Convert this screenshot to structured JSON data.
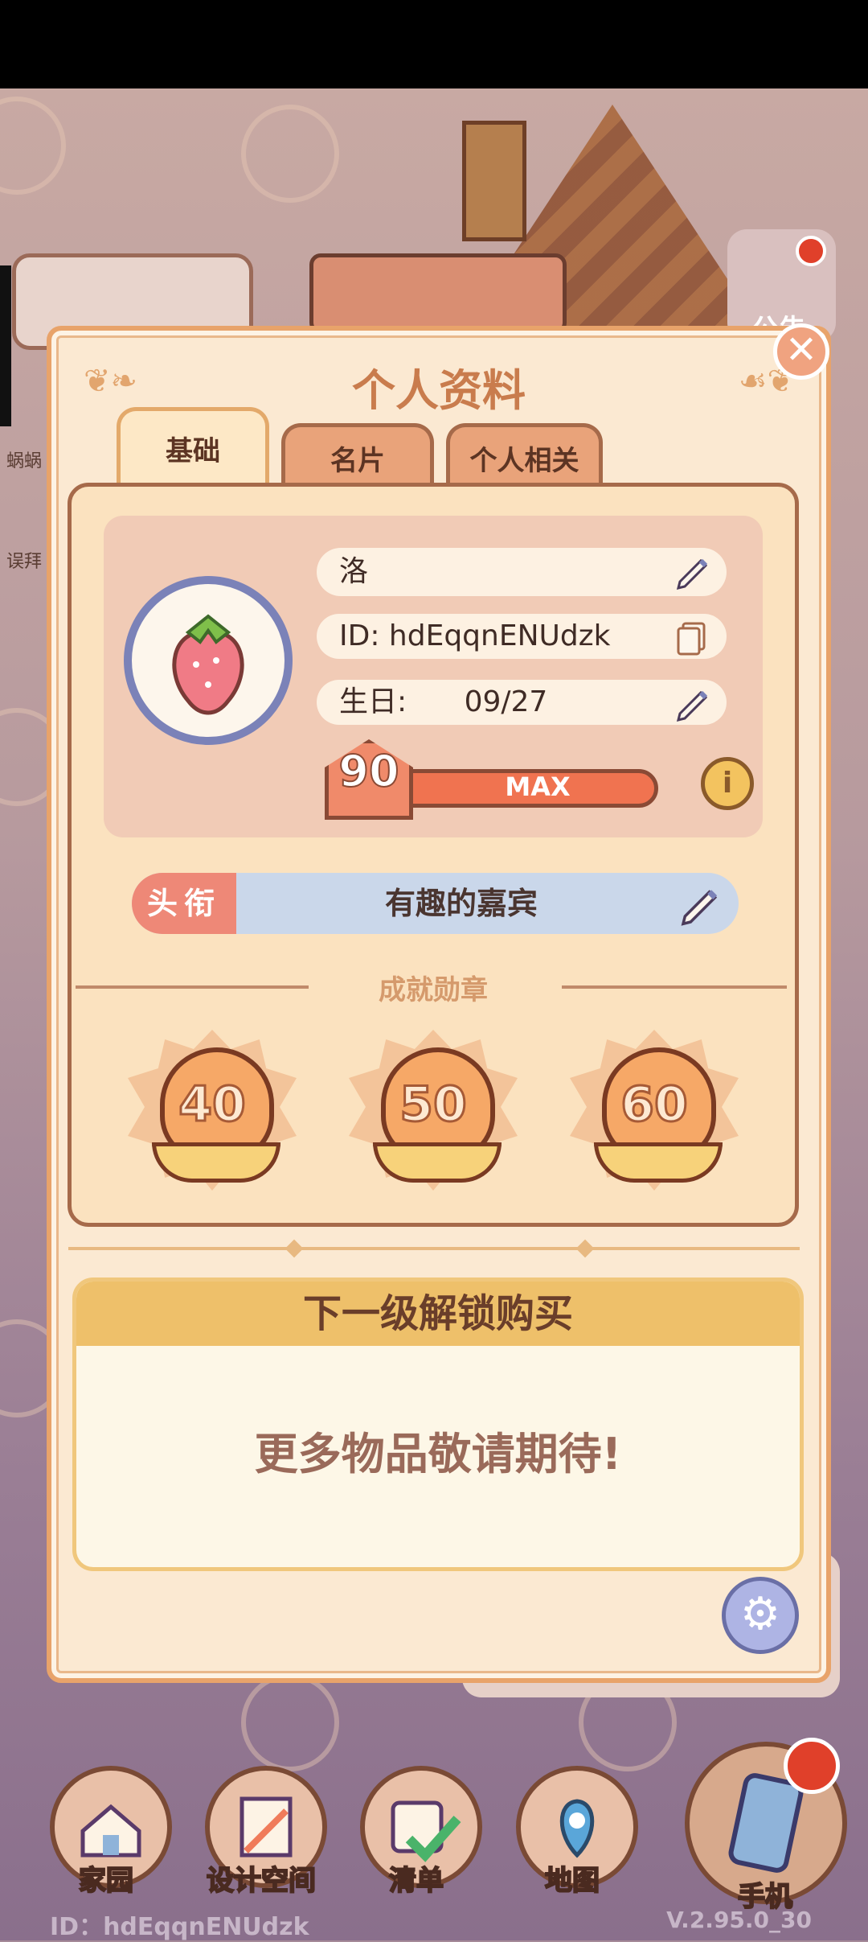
{
  "panel": {
    "title": "个人资料",
    "close_label": "✕",
    "tabs": [
      {
        "label": "基础",
        "active": true
      },
      {
        "label": "名片",
        "active": false
      },
      {
        "label": "个人相关",
        "active": false
      }
    ]
  },
  "profile": {
    "name": "洛",
    "id_text": "ID: hdEqqnENUdzk",
    "birthday_label": "生日:",
    "birthday_value": "09/27",
    "level": "90",
    "level_status": "MAX",
    "info_label": "i"
  },
  "title_bar": {
    "tag": "头衔",
    "title": "有趣的嘉宾"
  },
  "achievements": {
    "label": "成就勋章",
    "badges": [
      "40",
      "50",
      "60"
    ]
  },
  "unlock": {
    "header": "下一级解锁购买",
    "message": "更多物品敬请期待!"
  },
  "background": {
    "announcement_label": "公告",
    "side_tags": [
      "蜗蜗",
      "误拜"
    ]
  },
  "nav": {
    "items": [
      {
        "label": "家园",
        "icon": "house-icon"
      },
      {
        "label": "设计空间",
        "icon": "design-icon"
      },
      {
        "label": "清单",
        "icon": "checklist-icon"
      },
      {
        "label": "地图",
        "icon": "map-pin-icon"
      },
      {
        "label": "手机",
        "icon": "phone-icon"
      }
    ]
  },
  "footer": {
    "id": "ID：hdEqqnENUdzk",
    "version": "V.2.95.0_30"
  },
  "colors": {
    "panel_bg": "#fbe9d2",
    "accent": "#e8a36a",
    "title_tag": "#ee8877",
    "unlock_header": "#eec06a"
  }
}
